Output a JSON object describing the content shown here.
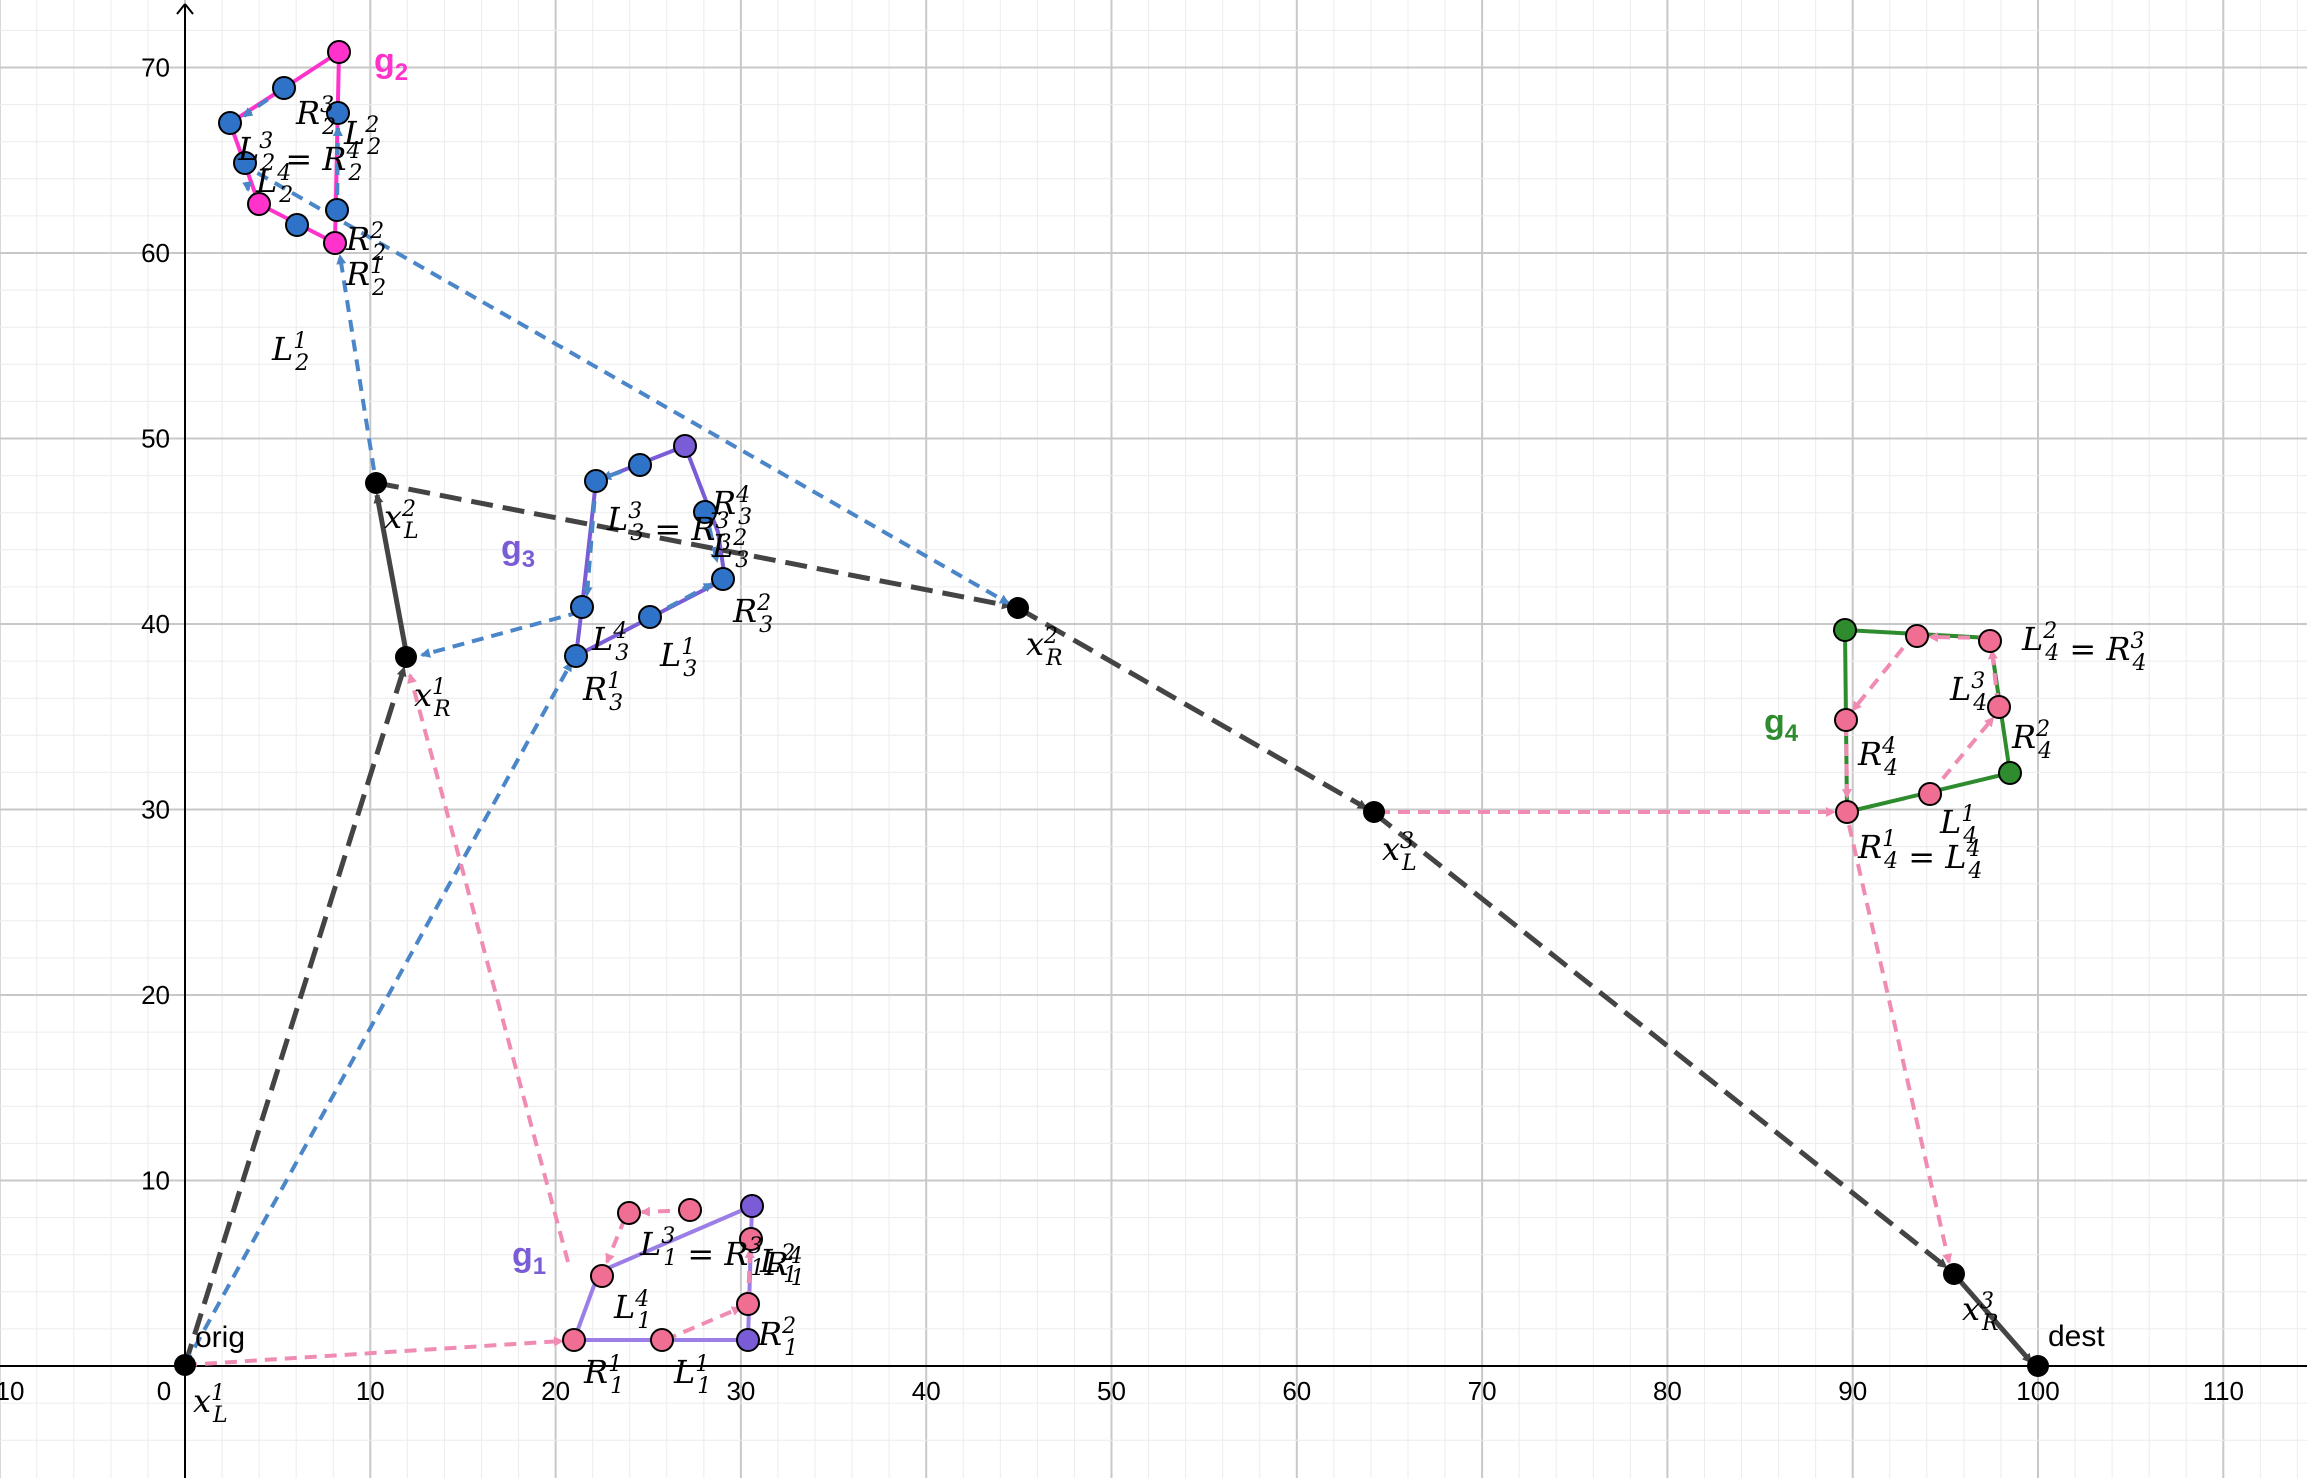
{
  "axes": {
    "x_ticks": [
      "10",
      "0",
      "10",
      "20",
      "30",
      "40",
      "50",
      "60",
      "70",
      "80",
      "90",
      "100",
      "110"
    ],
    "y_ticks": [
      "10",
      "20",
      "30",
      "40",
      "50",
      "60",
      "70"
    ]
  },
  "colors": {
    "black": "#000000",
    "dark_path": "#444444",
    "blue_path": "#4a86c8",
    "pink_path": "#f08cb4",
    "magenta": "#ff33cc",
    "purple": "#7a5cd6",
    "green": "#2e8b2e",
    "blue_point": "#2f73c9",
    "pink_point": "#f06e92"
  },
  "groups": [
    {
      "name": "g",
      "sub": "1",
      "color": "#7a5cd6"
    },
    {
      "name": "g",
      "sub": "2",
      "color": "#ff33cc"
    },
    {
      "name": "g",
      "sub": "3",
      "color": "#7a5cd6"
    },
    {
      "name": "g",
      "sub": "4",
      "color": "#2e8b2e"
    }
  ],
  "plain_labels": {
    "orig": "orig",
    "dest": "dest"
  },
  "math_labels": [
    {
      "id": "xL1",
      "parts": [
        [
          "x",
          "L",
          "1"
        ]
      ]
    },
    {
      "id": "xR1",
      "parts": [
        [
          "x",
          "R",
          "1"
        ]
      ]
    },
    {
      "id": "xL2",
      "parts": [
        [
          "x",
          "L",
          "2"
        ]
      ]
    },
    {
      "id": "xR2",
      "parts": [
        [
          "x",
          "R",
          "2"
        ]
      ]
    },
    {
      "id": "xL3",
      "parts": [
        [
          "x",
          "L",
          "3"
        ]
      ]
    },
    {
      "id": "xR3",
      "parts": [
        [
          "x",
          "R",
          "3"
        ]
      ]
    },
    {
      "id": "g1-R1",
      "parts": [
        [
          "R",
          "1",
          "1"
        ]
      ]
    },
    {
      "id": "g1-L1",
      "parts": [
        [
          "L",
          "1",
          "1"
        ]
      ]
    },
    {
      "id": "g1-R2",
      "parts": [
        [
          "R",
          "1",
          "2"
        ]
      ]
    },
    {
      "id": "g1-L2",
      "parts": [
        [
          "L",
          "1",
          "2"
        ]
      ]
    },
    {
      "id": "g1-L4",
      "parts": [
        [
          "L",
          "1",
          "4"
        ]
      ]
    },
    {
      "id": "g1-L3R3R4",
      "parts": [
        [
          "L",
          "1",
          "3"
        ],
        "=",
        [
          "R",
          "1",
          "3"
        ],
        [
          "R",
          "1",
          "4"
        ]
      ]
    },
    {
      "id": "g2-R1",
      "parts": [
        [
          "R",
          "2",
          "1"
        ]
      ]
    },
    {
      "id": "g2-R2",
      "parts": [
        [
          "R",
          "2",
          "2"
        ]
      ]
    },
    {
      "id": "g2-L1",
      "parts": [
        [
          "L",
          "2",
          "1"
        ]
      ]
    },
    {
      "id": "g2-L4",
      "parts": [
        [
          "L",
          "2",
          "4"
        ]
      ]
    },
    {
      "id": "g2-L3eqR4",
      "parts": [
        [
          "L",
          "2",
          "3"
        ],
        "=",
        [
          "R",
          "2",
          "4"
        ]
      ]
    },
    {
      "id": "g2-R3",
      "parts": [
        [
          "R",
          "2",
          "3"
        ]
      ]
    },
    {
      "id": "g2-L2",
      "parts": [
        [
          "L",
          "2",
          "2"
        ]
      ]
    },
    {
      "id": "g3-L3R3",
      "parts": [
        [
          "L",
          "3",
          "3"
        ],
        "=",
        [
          "R",
          "3",
          "3"
        ]
      ]
    },
    {
      "id": "g3-R4",
      "parts": [
        [
          "R",
          "3",
          "4"
        ]
      ]
    },
    {
      "id": "g3-L2",
      "parts": [
        [
          "L",
          "3",
          "2"
        ]
      ]
    },
    {
      "id": "g3-R2",
      "parts": [
        [
          "R",
          "3",
          "2"
        ]
      ]
    },
    {
      "id": "g3-L4",
      "parts": [
        [
          "L",
          "3",
          "4"
        ]
      ]
    },
    {
      "id": "g3-L1",
      "parts": [
        [
          "L",
          "3",
          "1"
        ]
      ]
    },
    {
      "id": "g3-R1",
      "parts": [
        [
          "R",
          "3",
          "1"
        ]
      ]
    },
    {
      "id": "g4-L2R3",
      "parts": [
        [
          "L",
          "4",
          "2"
        ],
        "=",
        [
          "R",
          "4",
          "3"
        ]
      ]
    },
    {
      "id": "g4-L3",
      "parts": [
        [
          "L",
          "4",
          "3"
        ]
      ]
    },
    {
      "id": "g4-R2",
      "parts": [
        [
          "R",
          "4",
          "2"
        ]
      ]
    },
    {
      "id": "g4-R4",
      "parts": [
        [
          "R",
          "4",
          "4"
        ]
      ]
    },
    {
      "id": "g4-R1L4",
      "parts": [
        [
          "R",
          "4",
          "1"
        ],
        "=",
        [
          "L",
          "4",
          "4"
        ]
      ]
    },
    {
      "id": "g4-L1",
      "parts": [
        [
          "L",
          "4",
          "1"
        ]
      ]
    }
  ]
}
